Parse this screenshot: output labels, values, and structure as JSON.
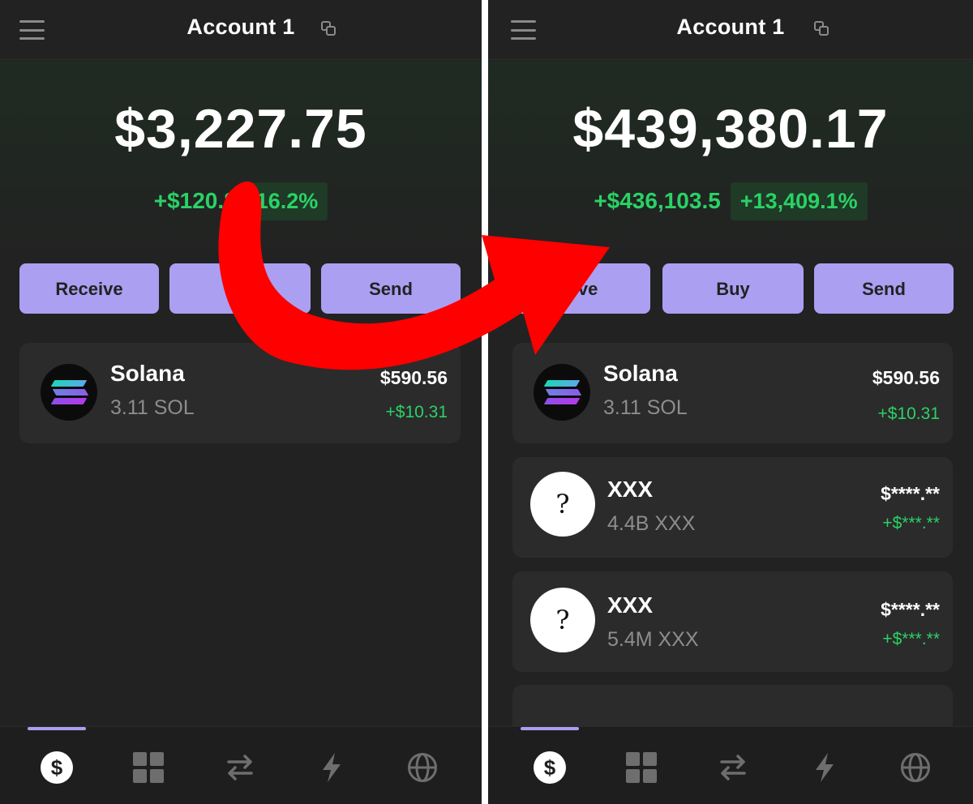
{
  "left": {
    "header": {
      "title": "Account 1"
    },
    "balance": "$3,227.75",
    "change_abs": "+$120.8",
    "change_pct": "16.2%",
    "buttons": {
      "receive": "Receive",
      "buy": "Bu",
      "send": "Send"
    },
    "tokens": [
      {
        "name": "Solana",
        "qty": "3.11 SOL",
        "value": "$590.56",
        "gain": "+$10.31"
      }
    ]
  },
  "right": {
    "header": {
      "title": "Account 1"
    },
    "balance": "$439,380.17",
    "change_abs": "+$436,103.5",
    "change_pct": "+13,409.1%",
    "buttons": {
      "receive": "eive",
      "buy": "Buy",
      "send": "Send"
    },
    "tokens": [
      {
        "name": "Solana",
        "qty": "3.11 SOL",
        "value": "$590.56",
        "gain": "+$10.31"
      },
      {
        "name": "XXX",
        "qty": "4.4B XXX",
        "value": "$****.**",
        "gain": "+$***.**",
        "icon": "?"
      },
      {
        "name": "XXX",
        "qty": "5.4M XXX",
        "value": "$****.**",
        "gain": "+$***.**",
        "icon": "?"
      }
    ]
  },
  "tabbar": {
    "wallet_symbol": "$"
  },
  "colors": {
    "background": "#222222",
    "card": "#2b2b2b",
    "accent": "#ab9ff2",
    "positive": "#2ad266",
    "arrow": "#ff0000"
  }
}
